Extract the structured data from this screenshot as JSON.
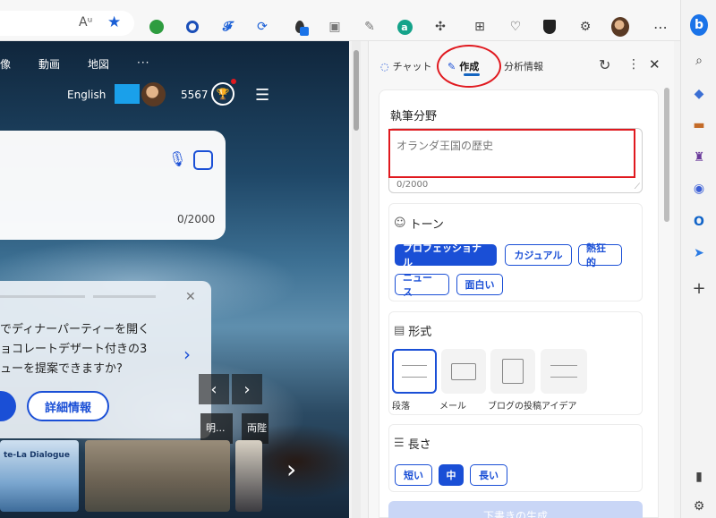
{
  "toolbar": {
    "read_aloud_glyph": "Aᵘ",
    "favorite_star": "★"
  },
  "webpage": {
    "nav": [
      "像",
      "動画",
      "地図",
      "···"
    ],
    "language": "English",
    "points": "5567",
    "char_count": "0/2000",
    "promo_text": [
      "でディナーパーティーを開く",
      "ョコレートデザート付きの3",
      "ューを提案できますか?"
    ],
    "promo_italic": "3",
    "details_button": "詳細情報",
    "caption_left": "明...",
    "caption_right": "両陛",
    "thumb_text": "te-La Dialogue"
  },
  "panel": {
    "tabs": [
      {
        "label": "チャット",
        "icon": "chat-icon"
      },
      {
        "label": "作成",
        "icon": "compose-icon",
        "active": true
      },
      {
        "label": "分析情報",
        "icon": "insights-icon"
      }
    ],
    "writing_topic": {
      "title": "執筆分野",
      "placeholder": "オランダ王国の歴史",
      "counter": "0/2000"
    },
    "tone": {
      "title": "トーン",
      "options": [
        "プロフェッショナル",
        "カジュアル",
        "熱狂的",
        "ニュース",
        "面白い"
      ],
      "selected": "プロフェッショナル"
    },
    "format": {
      "title": "形式",
      "options": [
        "段落",
        "メール",
        "ブログの投稿",
        "アイデア"
      ],
      "selected": "段落"
    },
    "length": {
      "title": "長さ",
      "options": [
        "短い",
        "中",
        "長い"
      ],
      "selected": "中"
    },
    "generate_button": "下書きの生成"
  },
  "colors": {
    "accent": "#1a4fd6",
    "annotation_red": "#e0191f"
  }
}
